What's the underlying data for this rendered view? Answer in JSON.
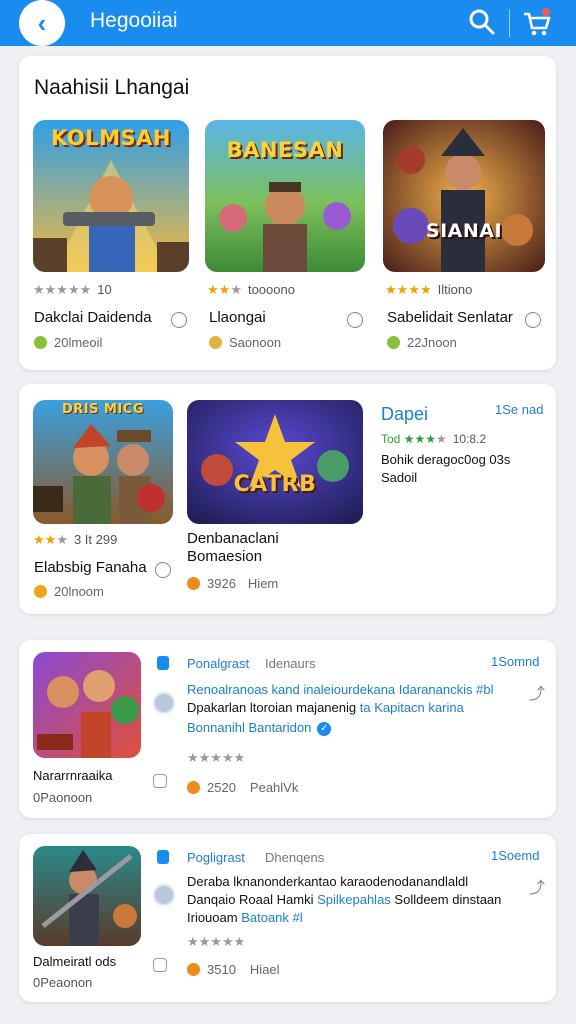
{
  "header": {
    "title": "Hegooiiai",
    "back_icon": "arrow-left-icon",
    "search_icon": "search-icon",
    "cart_icon": "cart-icon"
  },
  "section1": {
    "title": "Naahisii Lhangai",
    "items": [
      {
        "art_text": "KOLMSAH",
        "rating_text": "10",
        "stars": 0,
        "name": "Dakclai Daidenda",
        "meta": "20lmeoil"
      },
      {
        "art_text": "BANESAN",
        "rating_text": "toooono",
        "stars": 2,
        "name": "Llaongai",
        "meta": "Saonoon"
      },
      {
        "art_text": "SIANAI",
        "rating_text": "Iltiono",
        "stars": 4,
        "name": "Sabelidait Senlatar",
        "meta": "22Jnoon"
      }
    ]
  },
  "section2": {
    "item1": {
      "art_text": "DRIS MICG",
      "rating_text": "3 It 299",
      "stars": 2,
      "name": "Elabsbig Fanaha",
      "meta": "20lnoom"
    },
    "item2": {
      "art_text": "CATRB",
      "name_line1": "Denbanaclani",
      "name_line2": "Bomaesion",
      "meta_num": "3926",
      "meta_label": "Hiem"
    },
    "detail": {
      "title": "Dapei",
      "tag": "1Se nad",
      "rating_prefix": "Tod",
      "rating_text": "10:8.2",
      "desc_line1": "Bohik deragoc0og 03s",
      "desc_line2": "Sadoil"
    }
  },
  "post1": {
    "author": "Ponalgrast",
    "sub": "Idenaurs",
    "time": "1Somnd",
    "line1": "Renoalranoas kand inaleiourdekana Idarananckis",
    "hashtag1": "#bl",
    "line2_a": "Dpakarlan ltoroian majanenig",
    "line2_b": "ta Kapitacn karina",
    "line3": "Bonnanihl Bantaridon",
    "likes": "2520",
    "likes_label": "PeahlVk",
    "thumb_name": "Nararrnraaika",
    "thumb_meta": "0Paonoon"
  },
  "post2": {
    "author": "Pogligrast",
    "sub": "Dhenqens",
    "time": "1Soemd",
    "line1": "Deraba lknanonderkantao karaodenodanandlaldl",
    "line2_a": "Danqaio Roaal Hamki",
    "line2_b": "Spilkepahlas",
    "line2_c": "Solldeem dinstaan",
    "line3_a": "Iriouoam",
    "line3_b": "Batoank #l",
    "likes": "3510",
    "likes_label": "Hiael",
    "thumb_name": "Dalmeiratl ods",
    "thumb_meta": "0Peaonon"
  }
}
